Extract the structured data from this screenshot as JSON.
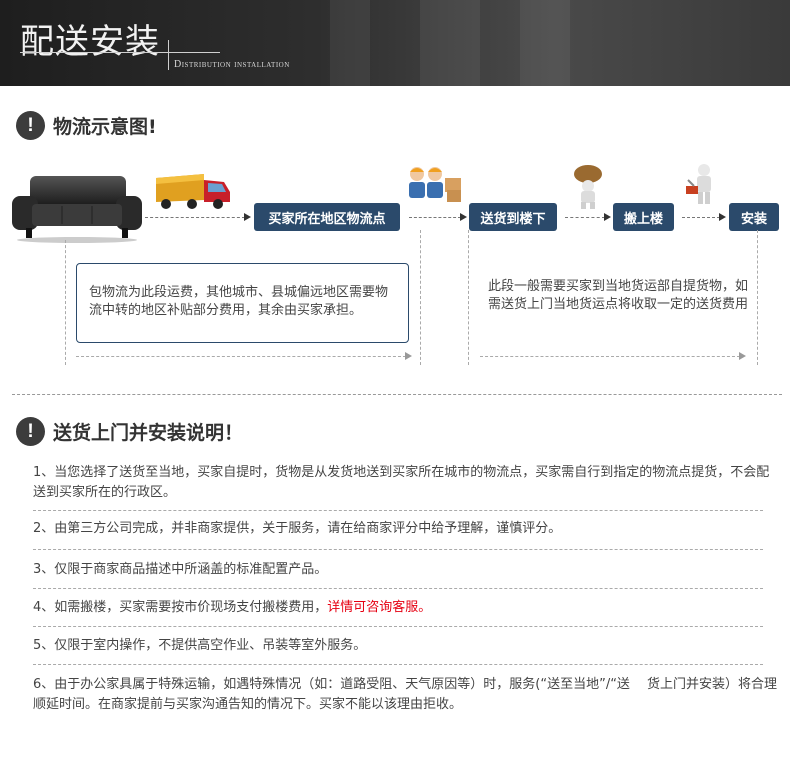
{
  "banner": {
    "title": "配送安装",
    "subtitle": "Distribution installation"
  },
  "section1": {
    "title": "物流示意图!",
    "steps": [
      "买家所在地区物流点",
      "送货到楼下",
      "搬上楼",
      "安装"
    ],
    "note_left": "包物流为此段运费，其他城市、县城偏远地区需要物流中转的地区补贴部分费用，其余由买家承担。",
    "note_right": "此段一般需要买家到当地货运部自提货物，如需送货上门当地货运点将收取一定的送货费用"
  },
  "section2": {
    "title": "送货上门并安装说明！",
    "items": [
      {
        "text": "1、当您选择了送货至当地，买家自提时，货物是从发货地送到买家所在城市的物流点，买家需自行到指定的物流点提货，不会配送到买家所在的行政区。"
      },
      {
        "text": "2、由第三方公司完成，并非商家提供，关于服务，请在给商家评分中给予理解，谨慎评分。"
      },
      {
        "text": "3、仅限于商家商品描述中所涵盖的标准配置产品。"
      },
      {
        "text": "4、如需搬楼，买家需要按市价现场支付搬楼费用，",
        "highlight": "详情可咨询客服。"
      },
      {
        "text": "5、仅限于室内操作，不提供高空作业、吊装等室外服务。"
      },
      {
        "text": "6、由于办公家具属于特殊运输，如遇特殊情况（如：道路受阻、天气原因等）时，服务(“送至当地”/“送　 货上门并安装）将合理顺延时间。在商家提前与买家沟通告知的情况下。买家不能以该理由拒收。"
      }
    ]
  },
  "colors": {
    "step_bg": "#2b4a6b",
    "highlight": "#e60012"
  },
  "icons": [
    "warning-icon",
    "sofa-image",
    "truck-image",
    "workers-image",
    "carrier-image",
    "installer-image"
  ]
}
